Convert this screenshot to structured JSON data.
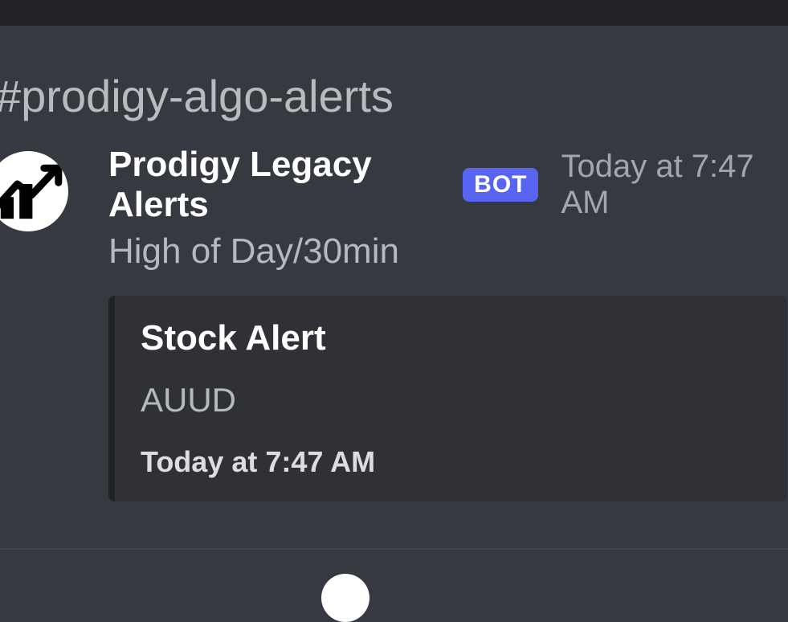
{
  "channel": {
    "name": "#prodigy-algo-alerts"
  },
  "message": {
    "author": "Prodigy Legacy Alerts",
    "bot_label": "BOT",
    "timestamp": "Today at 7:47 AM",
    "text": "High of Day/30min"
  },
  "embed": {
    "title": "Stock Alert",
    "description": "AUUD",
    "footer": "Today at 7:47 AM"
  }
}
